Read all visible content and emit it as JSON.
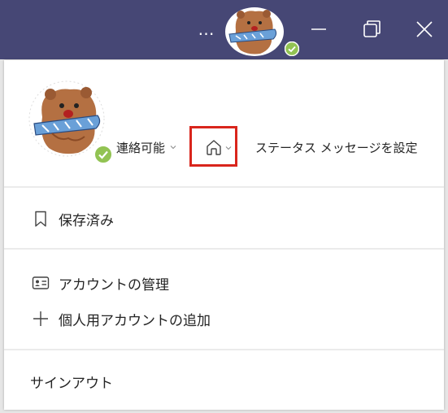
{
  "titlebar": {
    "more_label": "…",
    "background_color": "#464775"
  },
  "profile": {
    "availability_label": "連絡可能",
    "status_message_label": "ステータス メッセージを設定",
    "status_color": "#92c353",
    "location_icon": "home-icon",
    "location_highlight_color": "#d9251c"
  },
  "menu": {
    "saved_label": "保存済み",
    "manage_account_label": "アカウントの管理",
    "add_personal_account_label": "個人用アカウントの追加",
    "sign_out_label": "サインアウト"
  }
}
